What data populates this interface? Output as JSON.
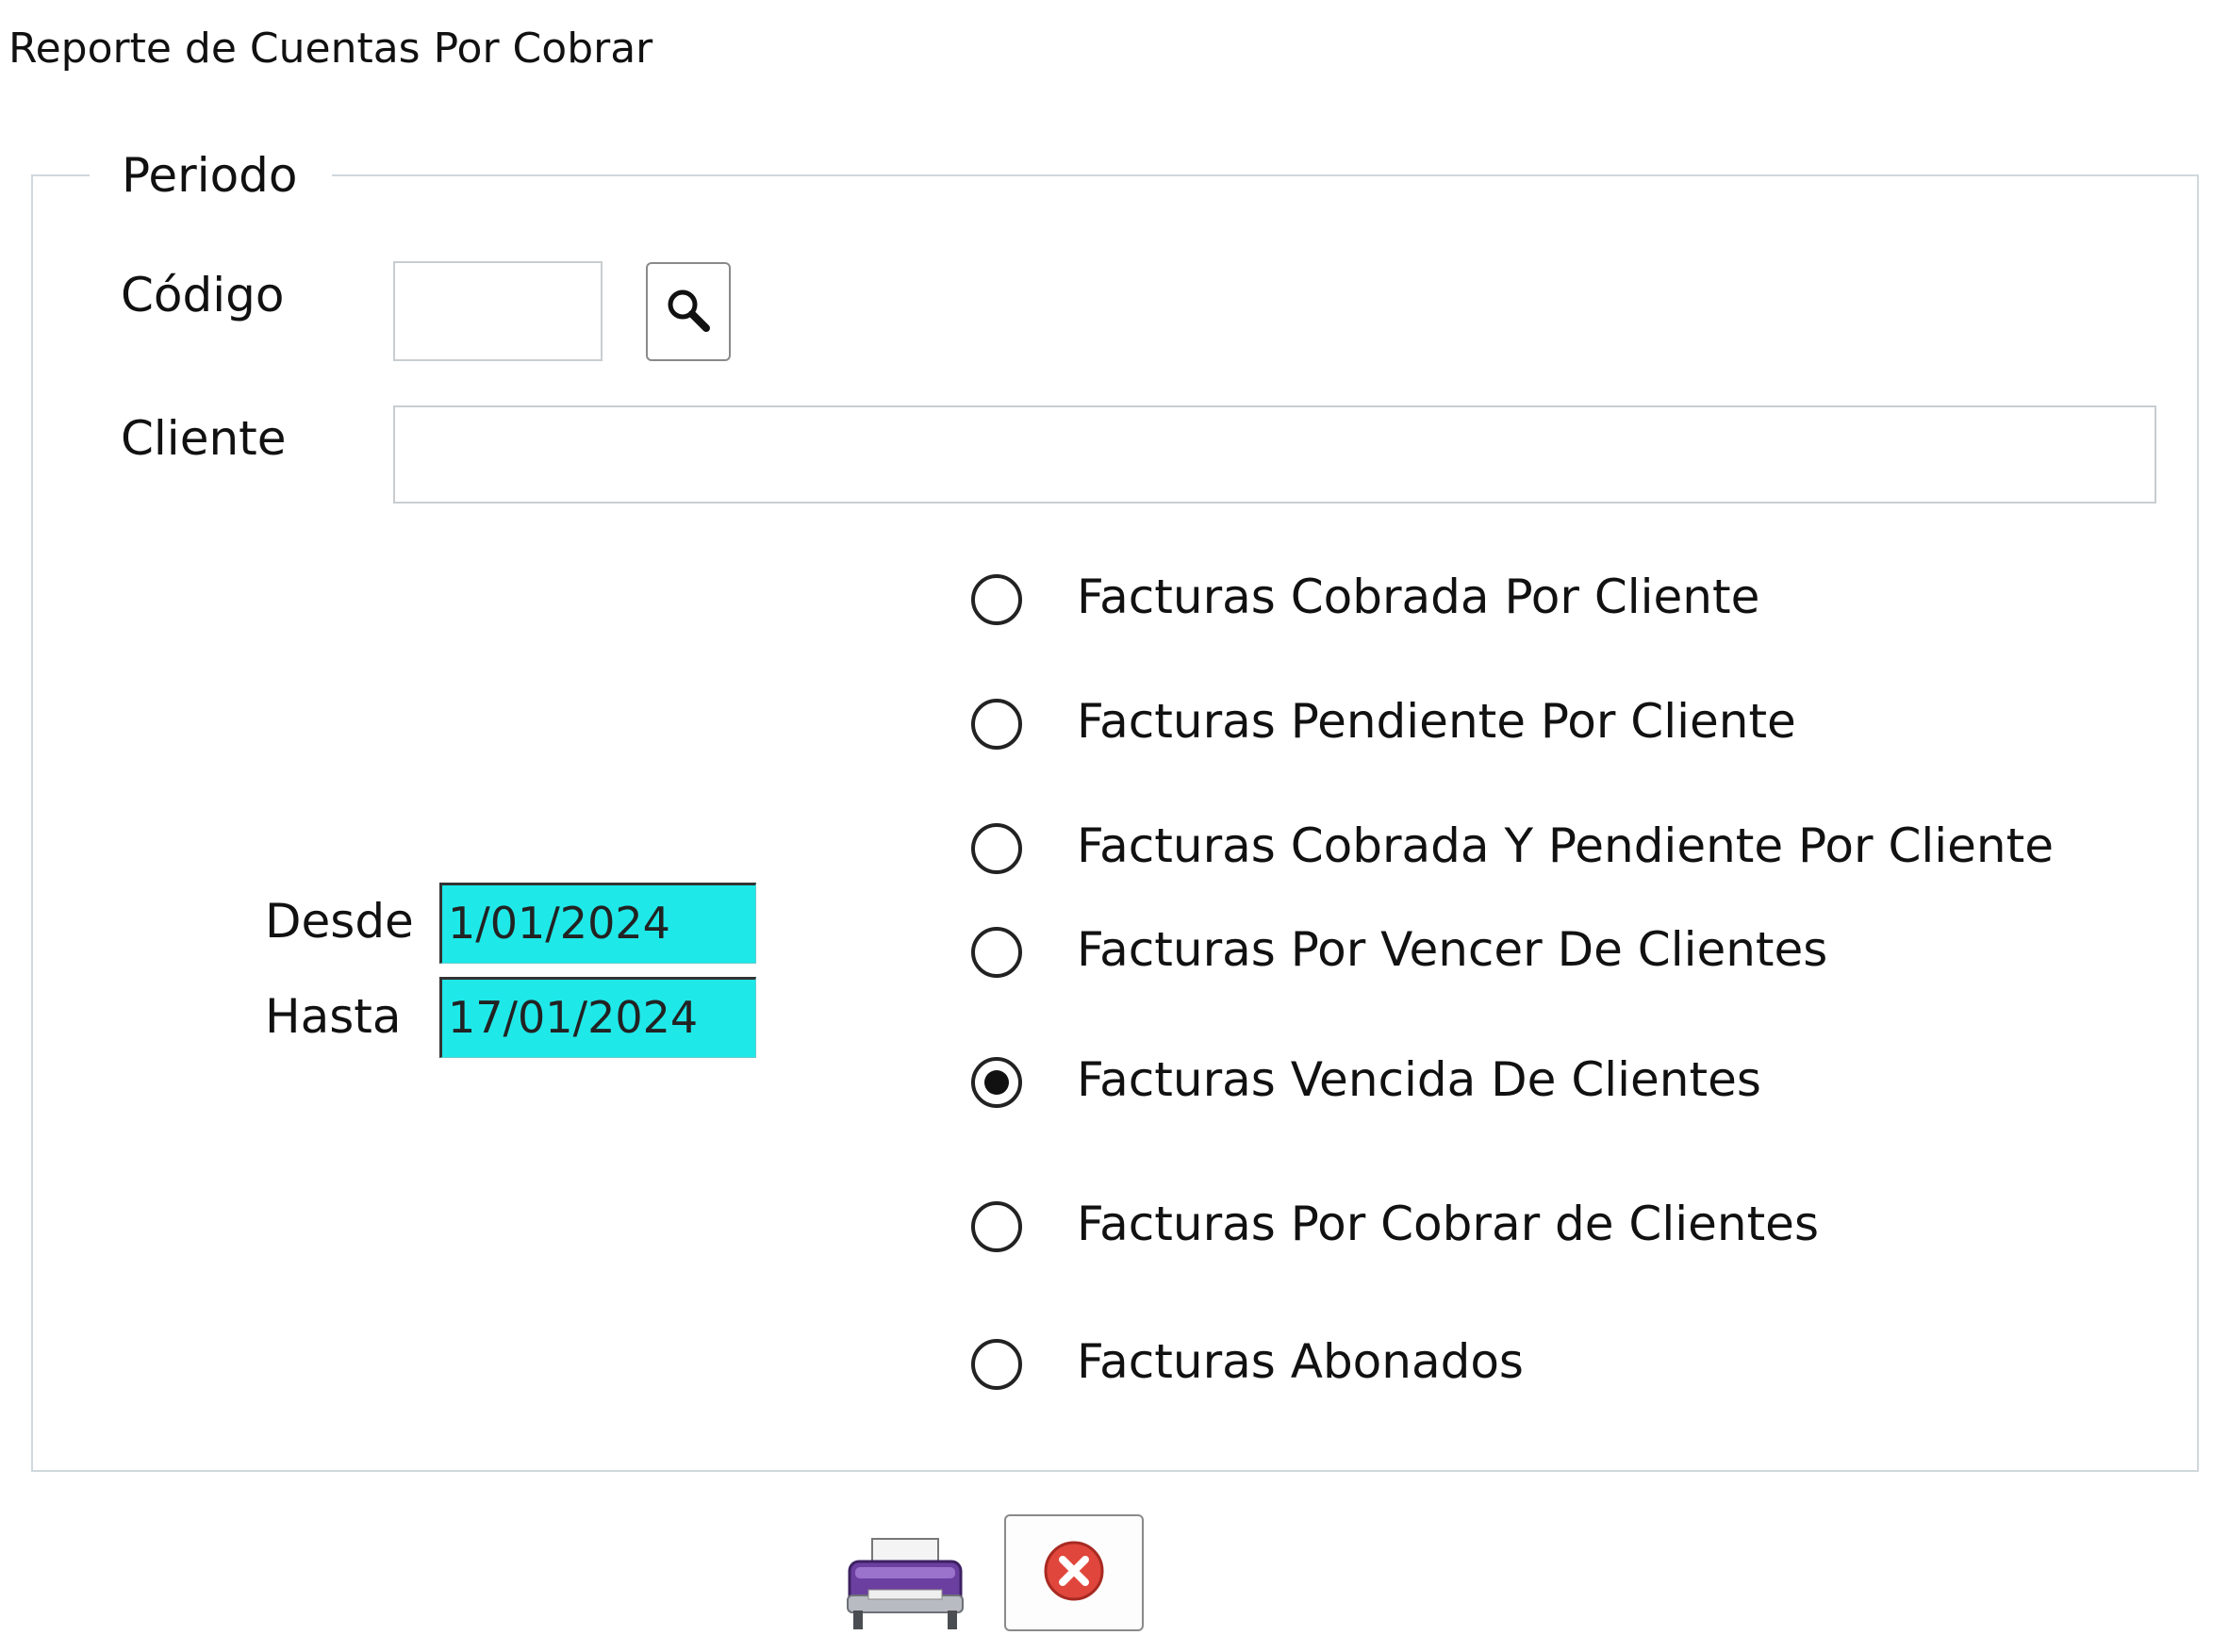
{
  "window": {
    "title": "Reporte de Cuentas Por Cobrar"
  },
  "group": {
    "legend": "Periodo"
  },
  "fields": {
    "codigo_label": "Código",
    "codigo_value": "",
    "cliente_label": "Cliente",
    "cliente_value": "",
    "desde_label": "Desde",
    "desde_value": "1/01/2024",
    "hasta_label": "Hasta",
    "hasta_value": "17/01/2024"
  },
  "report_options": [
    {
      "label": "Facturas Cobrada Por Cliente",
      "selected": false
    },
    {
      "label": "Facturas Pendiente Por Cliente",
      "selected": false
    },
    {
      "label": "Facturas Cobrada Y Pendiente Por Cliente",
      "selected": false
    },
    {
      "label": "Facturas Por Vencer De Clientes",
      "selected": false
    },
    {
      "label": "Facturas Vencida De Clientes",
      "selected": true
    },
    {
      "label": "Facturas Por Cobrar de Clientes",
      "selected": false
    },
    {
      "label": "Facturas Abonados",
      "selected": false
    }
  ],
  "icons": {
    "search": "magnifier-icon",
    "print": "printer-icon",
    "close": "close-icon"
  },
  "colors": {
    "date_field_bg": "#1fe8e8",
    "close_icon": "#e0463c",
    "printer_body": "#6b3fa0"
  }
}
